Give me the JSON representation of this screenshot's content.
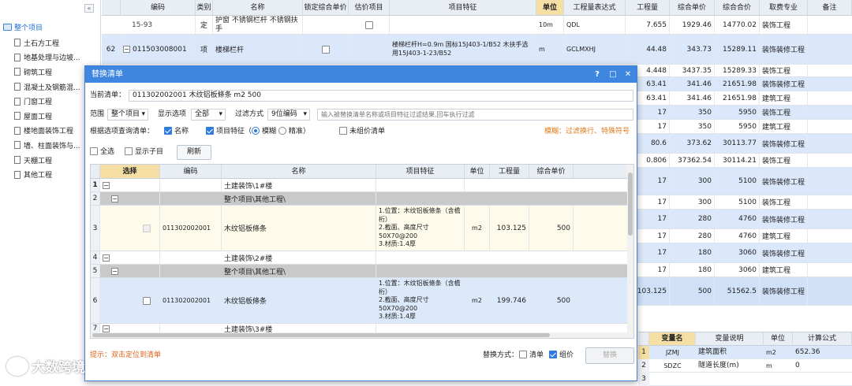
{
  "tree": {
    "collapse_icon": "«",
    "root": "整个项目",
    "items": [
      "土石方工程",
      "地基处理与边坡...",
      "砌筑工程",
      "混凝土及钢筋混...",
      "门窗工程",
      "屋面工程",
      "楼地面装饰工程",
      "墙、柱面装饰与...",
      "天棚工程",
      "其他工程"
    ]
  },
  "grid": {
    "headers": [
      "编码",
      "类别",
      "名称",
      "锁定综合单价",
      "估价项目",
      "项目特征",
      "单位",
      "工程量表达式",
      "工程量",
      "综合单价",
      "综合合价",
      "取费专业",
      "备注"
    ],
    "rows": [
      {
        "no": "",
        "code": "15-93",
        "type": "定",
        "name": "护窗 不锈钢栏杆 不锈钢扶手",
        "feature": "",
        "unit": "10m",
        "expr": "QDL",
        "qty": "7.655",
        "price": "1929.46",
        "total": "14770.02",
        "fee": "装饰工程"
      },
      {
        "no": "62",
        "code": "011503008001",
        "type": "项",
        "name": "楼梯栏杆",
        "feature": "楼梯栏杆H=0.9m 国标15J403-1/B52 木扶手选用15J403-1-23/B52",
        "unit": "m",
        "expr": "GCLMXHJ",
        "qty": "44.48",
        "price": "343.73",
        "total": "15289.11",
        "fee": "装饰装修工程"
      },
      {
        "qty": "4.448",
        "price": "3437.35",
        "total": "15289.33",
        "fee": "装饰工程"
      },
      {
        "qty": "63.41",
        "price": "341.46",
        "total": "21651.98",
        "fee": "装饰装修工程"
      },
      {
        "qty": "63.41",
        "price": "341.46",
        "total": "21651.98",
        "fee": "建筑工程"
      },
      {
        "qty": "17",
        "price": "350",
        "total": "5950",
        "fee": "装饰工程"
      },
      {
        "qty": "17",
        "price": "350",
        "total": "5950",
        "fee": "建筑工程"
      },
      {
        "qty": "80.6",
        "price": "373.62",
        "total": "30113.77",
        "fee": "装饰装修工程"
      },
      {
        "qty": "0.806",
        "price": "37362.54",
        "total": "30114.21",
        "fee": "装饰工程"
      },
      {
        "qty": "17",
        "price": "300",
        "total": "5100",
        "fee": "装饰装修工程"
      },
      {
        "qty": "17",
        "price": "300",
        "total": "5100",
        "fee": "装饰工程"
      },
      {
        "qty": "17",
        "price": "280",
        "total": "4760",
        "fee": "装饰装修工程"
      },
      {
        "qty": "17",
        "price": "280",
        "total": "4760",
        "fee": "建筑工程"
      },
      {
        "qty": "17",
        "price": "180",
        "total": "3060",
        "fee": "装饰装修工程"
      },
      {
        "qty": "17",
        "price": "180",
        "total": "3060",
        "fee": "建筑工程"
      },
      {
        "qty": "103.125",
        "price": "500",
        "total": "51562.5",
        "fee": "装饰装修工程"
      }
    ]
  },
  "var_panel": {
    "headers": [
      "变量名",
      "变量说明",
      "单位",
      "计算公式"
    ],
    "rows": [
      {
        "no": "1",
        "name": "JZMJ",
        "desc": "建筑面积",
        "unit": "m2",
        "formula": "652.36"
      },
      {
        "no": "2",
        "name": "SDZC",
        "desc": "隧道长度(m)",
        "unit": "m",
        "formula": "0"
      },
      {
        "no": "3",
        "name": "",
        "desc": "",
        "unit": "",
        "formula": ""
      }
    ]
  },
  "dialog": {
    "title": "替换清单",
    "help": "?",
    "restore": "□",
    "close": "✕",
    "current_label": "当前清单：",
    "current_value": "011302002001 木纹铝板條条 m2 500",
    "scope_label": "范围",
    "scope_value": "整个项目",
    "show_label": "显示选项",
    "show_value": "全部",
    "filter_label": "过滤方式",
    "filter_value": "9位编码",
    "search_placeholder": "输入被替换清单名称或项目特征过滤结果,回车执行过滤",
    "query_label": "根据选项查询清单：",
    "opt_name": "名称",
    "opt_feature": "项目特征",
    "opt_fuzzy": "模糊",
    "opt_exact": "精准",
    "opt_unpriced": "未组价清单",
    "hint_fuzzy": "模糊：过滤换行、特殊符号",
    "select_all": "全选",
    "show_children": "显示子目",
    "refresh": "刷新",
    "table_headers": [
      "选择",
      "编码",
      "名称",
      "项目特征",
      "单位",
      "工程量",
      "综合单价"
    ],
    "table_rows": [
      {
        "no": "1",
        "code": "",
        "name": "土建装饰\\1#楼",
        "feature": "",
        "unit": "",
        "qty": "",
        "price": ""
      },
      {
        "no": "2",
        "code": "",
        "name": "整个项目\\其他工程\\",
        "feature": "",
        "unit": "",
        "qty": "",
        "price": ""
      },
      {
        "no": "3",
        "code": "011302002001",
        "name": "木纹铝板條条",
        "feature": "1.位置：木纹铝板條条（含檐桁）\n2.截面、高度尺寸50X70@200\n3.材质:1.4厚",
        "unit": "m2",
        "qty": "103.125",
        "price": "500"
      },
      {
        "no": "4",
        "code": "",
        "name": "土建装饰\\2#楼",
        "feature": "",
        "unit": "",
        "qty": "",
        "price": ""
      },
      {
        "no": "5",
        "code": "",
        "name": "整个项目\\其他工程\\",
        "feature": "",
        "unit": "",
        "qty": "",
        "price": ""
      },
      {
        "no": "6",
        "code": "011302002001",
        "name": "木纹铝板條条",
        "feature": "1.位置：木纹铝板條条（含檐桁）\n2.截面、高度尺寸50X70@200\n3.材质:1.4厚",
        "unit": "m2",
        "qty": "199.746",
        "price": "500"
      },
      {
        "no": "7",
        "code": "",
        "name": "土建装饰\\3#楼",
        "feature": "",
        "unit": "",
        "qty": "",
        "price": ""
      }
    ],
    "footer_hint": "提示：双击定位到清单",
    "replace_mode_label": "替换方式：",
    "mode_list": "清单",
    "mode_price": "组价",
    "replace_btn": "替换"
  },
  "watermark": "大数跨境"
}
